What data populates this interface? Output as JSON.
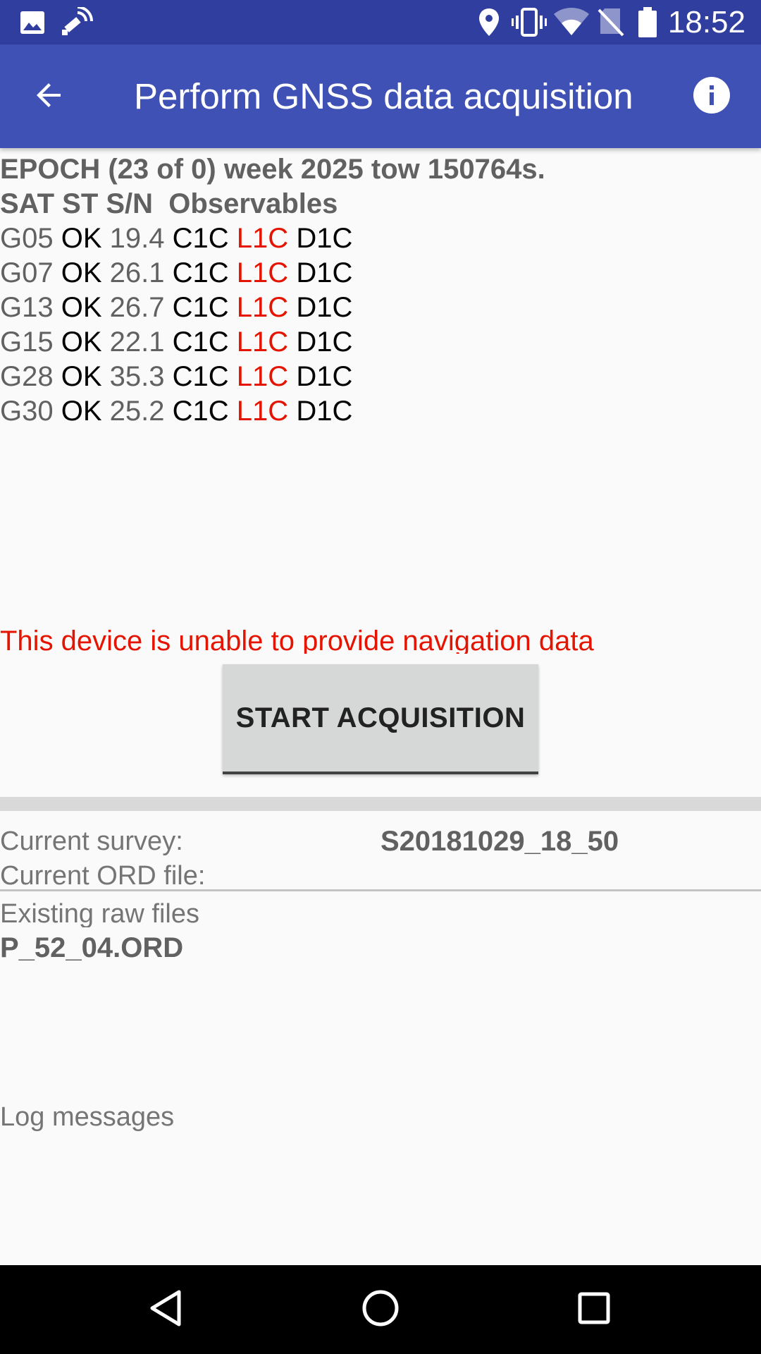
{
  "status_bar": {
    "time": "18:52",
    "icons": [
      "image-icon",
      "satellite-signal-icon",
      "location-pin-icon",
      "vibrate-icon",
      "wifi-icon",
      "no-sim-icon",
      "battery-icon"
    ]
  },
  "app_bar": {
    "title": "Perform GNSS data acquisition",
    "back_icon": "back-arrow-icon",
    "info_icon": "info-icon"
  },
  "epoch": {
    "line": "EPOCH (23 of 0) week 2025 tow 150764s.",
    "header": "SAT ST S/N  Observables",
    "satellites": [
      {
        "sat": "G05",
        "st": "OK",
        "sn": "19.4",
        "obs1": "C1C",
        "obs2": "L1C",
        "obs3": "D1C"
      },
      {
        "sat": "G07",
        "st": "OK",
        "sn": "26.1",
        "obs1": "C1C",
        "obs2": "L1C",
        "obs3": "D1C"
      },
      {
        "sat": "G13",
        "st": "OK",
        "sn": "26.7",
        "obs1": "C1C",
        "obs2": "L1C",
        "obs3": "D1C"
      },
      {
        "sat": "G15",
        "st": "OK",
        "sn": "22.1",
        "obs1": "C1C",
        "obs2": "L1C",
        "obs3": "D1C"
      },
      {
        "sat": "G28",
        "st": "OK",
        "sn": "35.3",
        "obs1": "C1C",
        "obs2": "L1C",
        "obs3": "D1C"
      },
      {
        "sat": "G30",
        "st": "OK",
        "sn": "25.2",
        "obs1": "C1C",
        "obs2": "L1C",
        "obs3": "D1C"
      }
    ]
  },
  "warning": "This device is unable to provide navigation data",
  "start_button_label": "START ACQUISITION",
  "survey": {
    "label": "Current survey:",
    "value": "S20181029_18_50",
    "ord_label": "Current ORD file:"
  },
  "raw_files": {
    "label": "Existing raw files",
    "files": [
      "P_52_04.ORD"
    ]
  },
  "log": {
    "label": "Log messages"
  },
  "nav_bar": {
    "icons": [
      "back-triangle-icon",
      "home-circle-icon",
      "recents-square-icon"
    ]
  },
  "colors": {
    "status_bar": "#303f9f",
    "app_bar": "#3f51b5",
    "warning_red": "#e51400",
    "button_bg": "#d6d7d7"
  }
}
